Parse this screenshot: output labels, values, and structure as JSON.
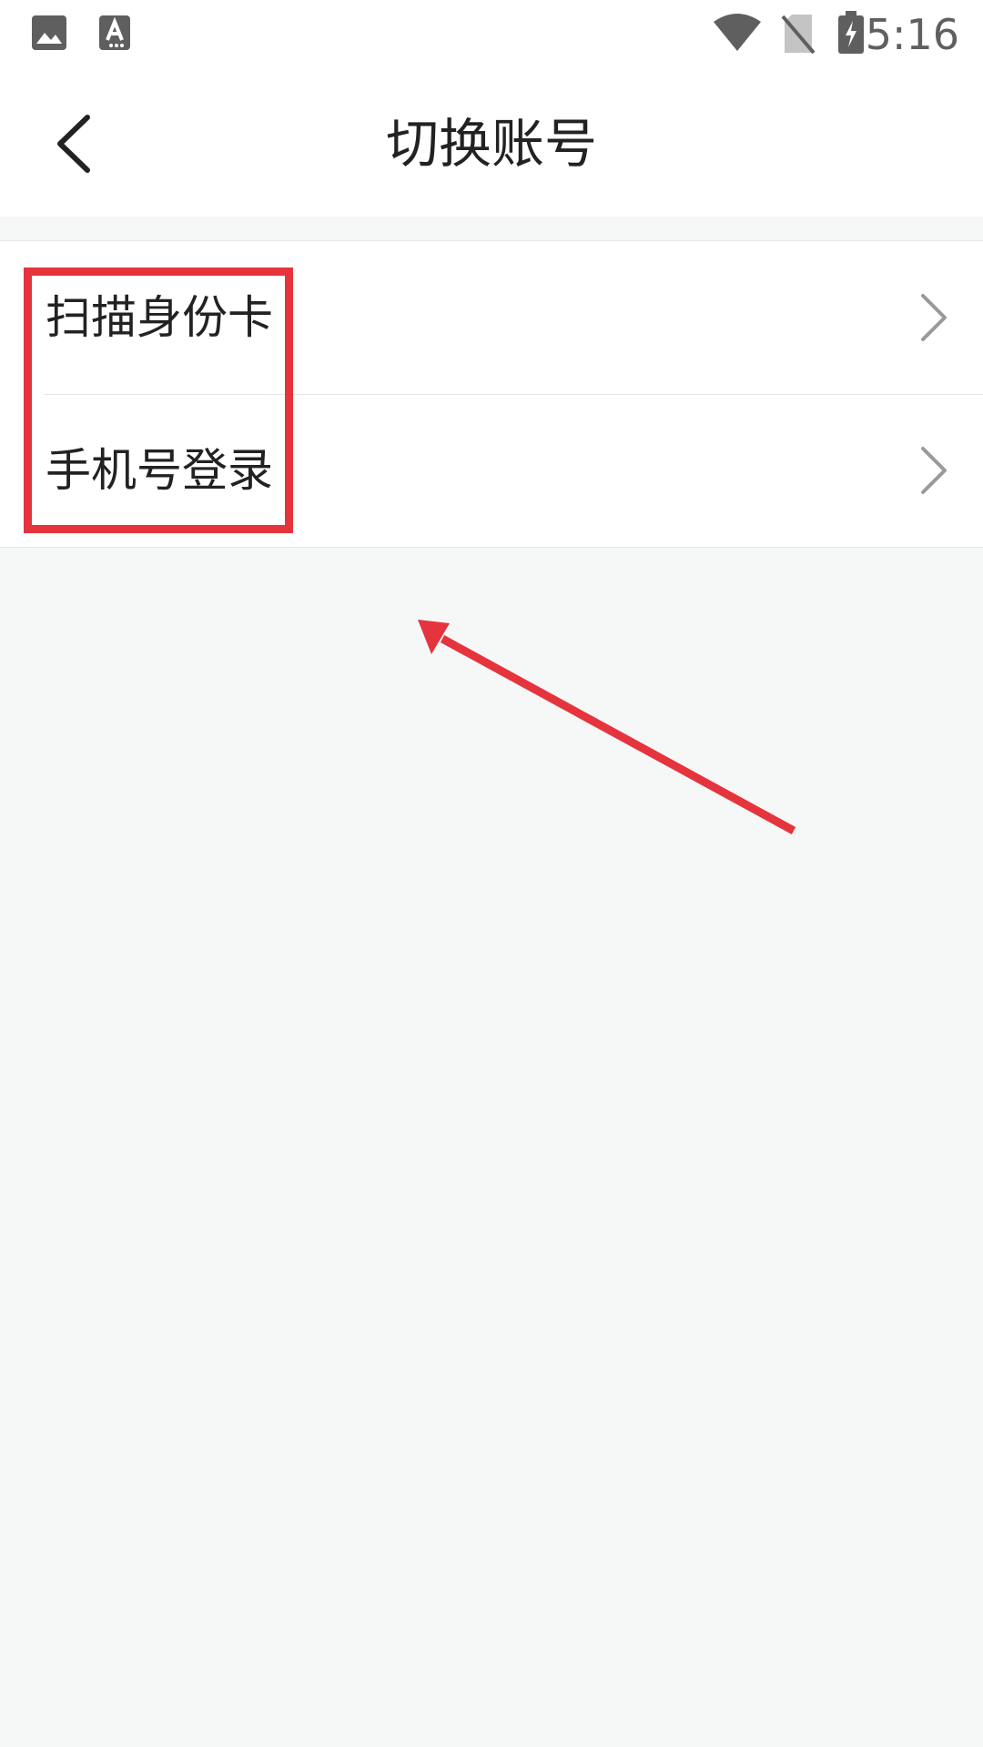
{
  "status_bar": {
    "time": "5:16",
    "icons": [
      "image-icon",
      "text-a-icon",
      "wifi-icon",
      "no-sim-icon",
      "battery-charging-icon"
    ]
  },
  "header": {
    "back_icon": "chevron-left-icon",
    "title": "切换账号"
  },
  "list": {
    "items": [
      {
        "label": "扫描身份卡",
        "icon": "chevron-right-icon"
      },
      {
        "label": "手机号登录",
        "icon": "chevron-right-icon"
      }
    ]
  },
  "annotations": {
    "color": "#e5343d",
    "shapes": [
      "highlight-box",
      "arrow"
    ]
  },
  "colors": {
    "page_background": "#f6f7f7",
    "surface": "#ffffff",
    "divider": "#e6e6e6",
    "text_primary": "#222222",
    "status_icons": "#5f5f5f",
    "chevron": "#9a9a9a"
  }
}
